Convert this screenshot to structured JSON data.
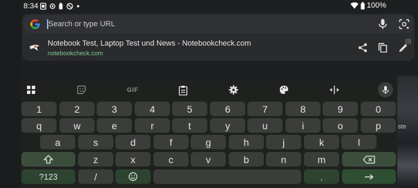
{
  "status_bar": {
    "time": "8:34",
    "battery": "100%",
    "icons": [
      "screen-record-icon",
      "vpn-icon",
      "battery-saver-icon",
      "do-not-disturb-icon",
      "dot-icon",
      "wifi-icon",
      "battery-icon"
    ]
  },
  "omnibox": {
    "placeholder": "Search or type URL",
    "value": ""
  },
  "suggestion": {
    "title": "Notebook Test, Laptop Test und News - Notebookcheck.com",
    "url": "notebookcheck.com"
  },
  "background": {
    "partial_text": "ste"
  },
  "keyboard": {
    "toolbar": [
      {
        "name": "apps-icon"
      },
      {
        "name": "sticker-icon"
      },
      {
        "name": "gif-button",
        "label": "GIF"
      },
      {
        "name": "clipboard-icon"
      },
      {
        "name": "settings-icon"
      },
      {
        "name": "theme-palette-icon"
      },
      {
        "name": "cursor-move-icon"
      },
      {
        "name": "voice-input-icon"
      }
    ],
    "row_numbers": [
      "1",
      "2",
      "3",
      "4",
      "5",
      "6",
      "7",
      "8",
      "9",
      "0"
    ],
    "row1": [
      "q",
      "w",
      "e",
      "r",
      "t",
      "y",
      "u",
      "i",
      "o",
      "p"
    ],
    "row2": [
      "a",
      "s",
      "d",
      "f",
      "g",
      "h",
      "j",
      "k",
      "l"
    ],
    "row3": [
      "z",
      "x",
      "c",
      "v",
      "b",
      "n",
      "m"
    ],
    "symbols_label": "?123",
    "slash_label": "/",
    "period_label": "."
  },
  "colors": {
    "url_green": "#81c995",
    "accent_blue": "#8ab4f8",
    "function_key": "#2c4430"
  }
}
